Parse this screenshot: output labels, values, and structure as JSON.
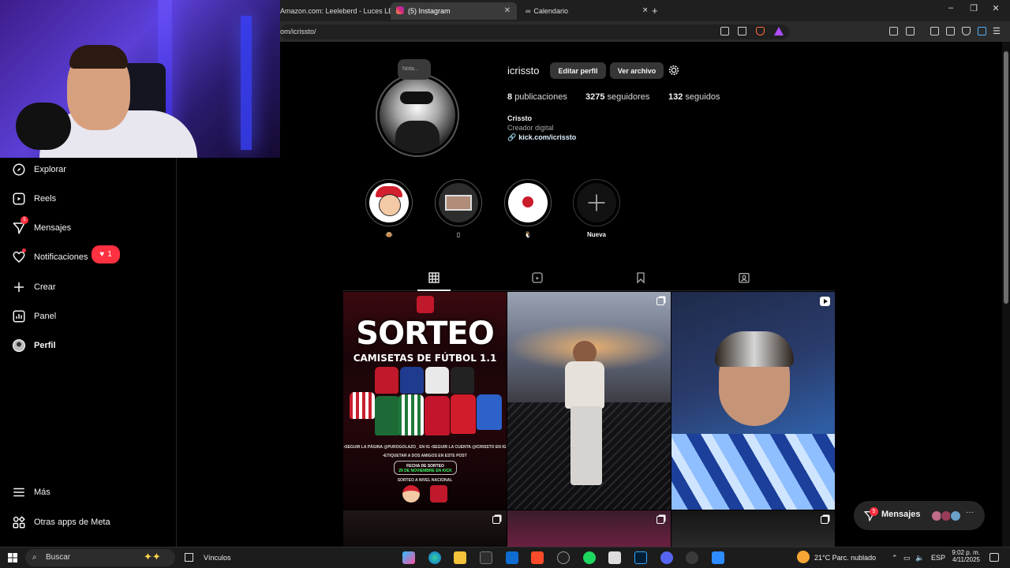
{
  "browser": {
    "tabs": [
      {
        "label": "Amazon.com: Leeleberd - Luces LED",
        "active": false
      },
      {
        "label": "(5) Instagram",
        "active": true
      },
      {
        "label": "Calendario",
        "active": false
      }
    ],
    "new_tab_label": "+",
    "url": "om/icrissto/"
  },
  "sidebar": {
    "items": [
      {
        "label": "Explorar",
        "icon": "compass-icon"
      },
      {
        "label": "Reels",
        "icon": "reels-icon"
      },
      {
        "label": "Mensajes",
        "icon": "messenger-icon",
        "badge": "5"
      },
      {
        "label": "Notificaciones",
        "icon": "heart-icon"
      },
      {
        "label": "Crear",
        "icon": "plus-icon"
      },
      {
        "label": "Panel",
        "icon": "chart-icon"
      },
      {
        "label": "Perfil",
        "icon": "avatar-icon"
      }
    ],
    "notif_count": "1",
    "more_label": "Más",
    "meta_label": "Otras apps de Meta"
  },
  "profile": {
    "note_placeholder": "Nota...",
    "username": "icrissto",
    "edit_button": "Editar perfil",
    "archive_button": "Ver archivo",
    "posts_count": "8",
    "posts_label": "publicaciones",
    "followers_count": "3275",
    "followers_label": "seguidores",
    "following_count": "132",
    "following_label": "seguidos",
    "display_name": "Crissto",
    "category": "Creador digital",
    "link": "kick.com/icrissto"
  },
  "highlights": [
    {
      "label": "🐵"
    },
    {
      "label": "▯"
    },
    {
      "label": "🐧"
    },
    {
      "label": "Nueva"
    }
  ],
  "posts": {
    "first_post": {
      "title": "SORTEO",
      "subtitle": "CAMISETAS DE FÚTBOL 1.1",
      "rule1": "•SEGUIR LA PÁGINA @PUROGOLAZO_ EN IG  •SEGUIR LA CUENTA @ICRISSTO EN IG",
      "rule2": "•ETIQUETAR A DOS AMIGOS EN ESTE POST",
      "date_label": "FECHA DE SORTEO",
      "date_value": "29 DE NOVIEMBRE EN KICK",
      "scope": "SORTEO A NIVEL NACIONAL"
    }
  },
  "messages_bar": {
    "label": "Mensajes",
    "badge": "5",
    "more": "···"
  },
  "taskbar": {
    "search_placeholder": "Buscar",
    "vinculos": "Vínculos",
    "weather": "21°C  Parc. nublado",
    "lang": "ESP",
    "time": "9:02 p. m.",
    "date": "4/11/2025"
  },
  "colors": {
    "background": "#000000",
    "badge": "#ff3040",
    "button": "#363636",
    "muted_text": "#a8a8a8"
  }
}
